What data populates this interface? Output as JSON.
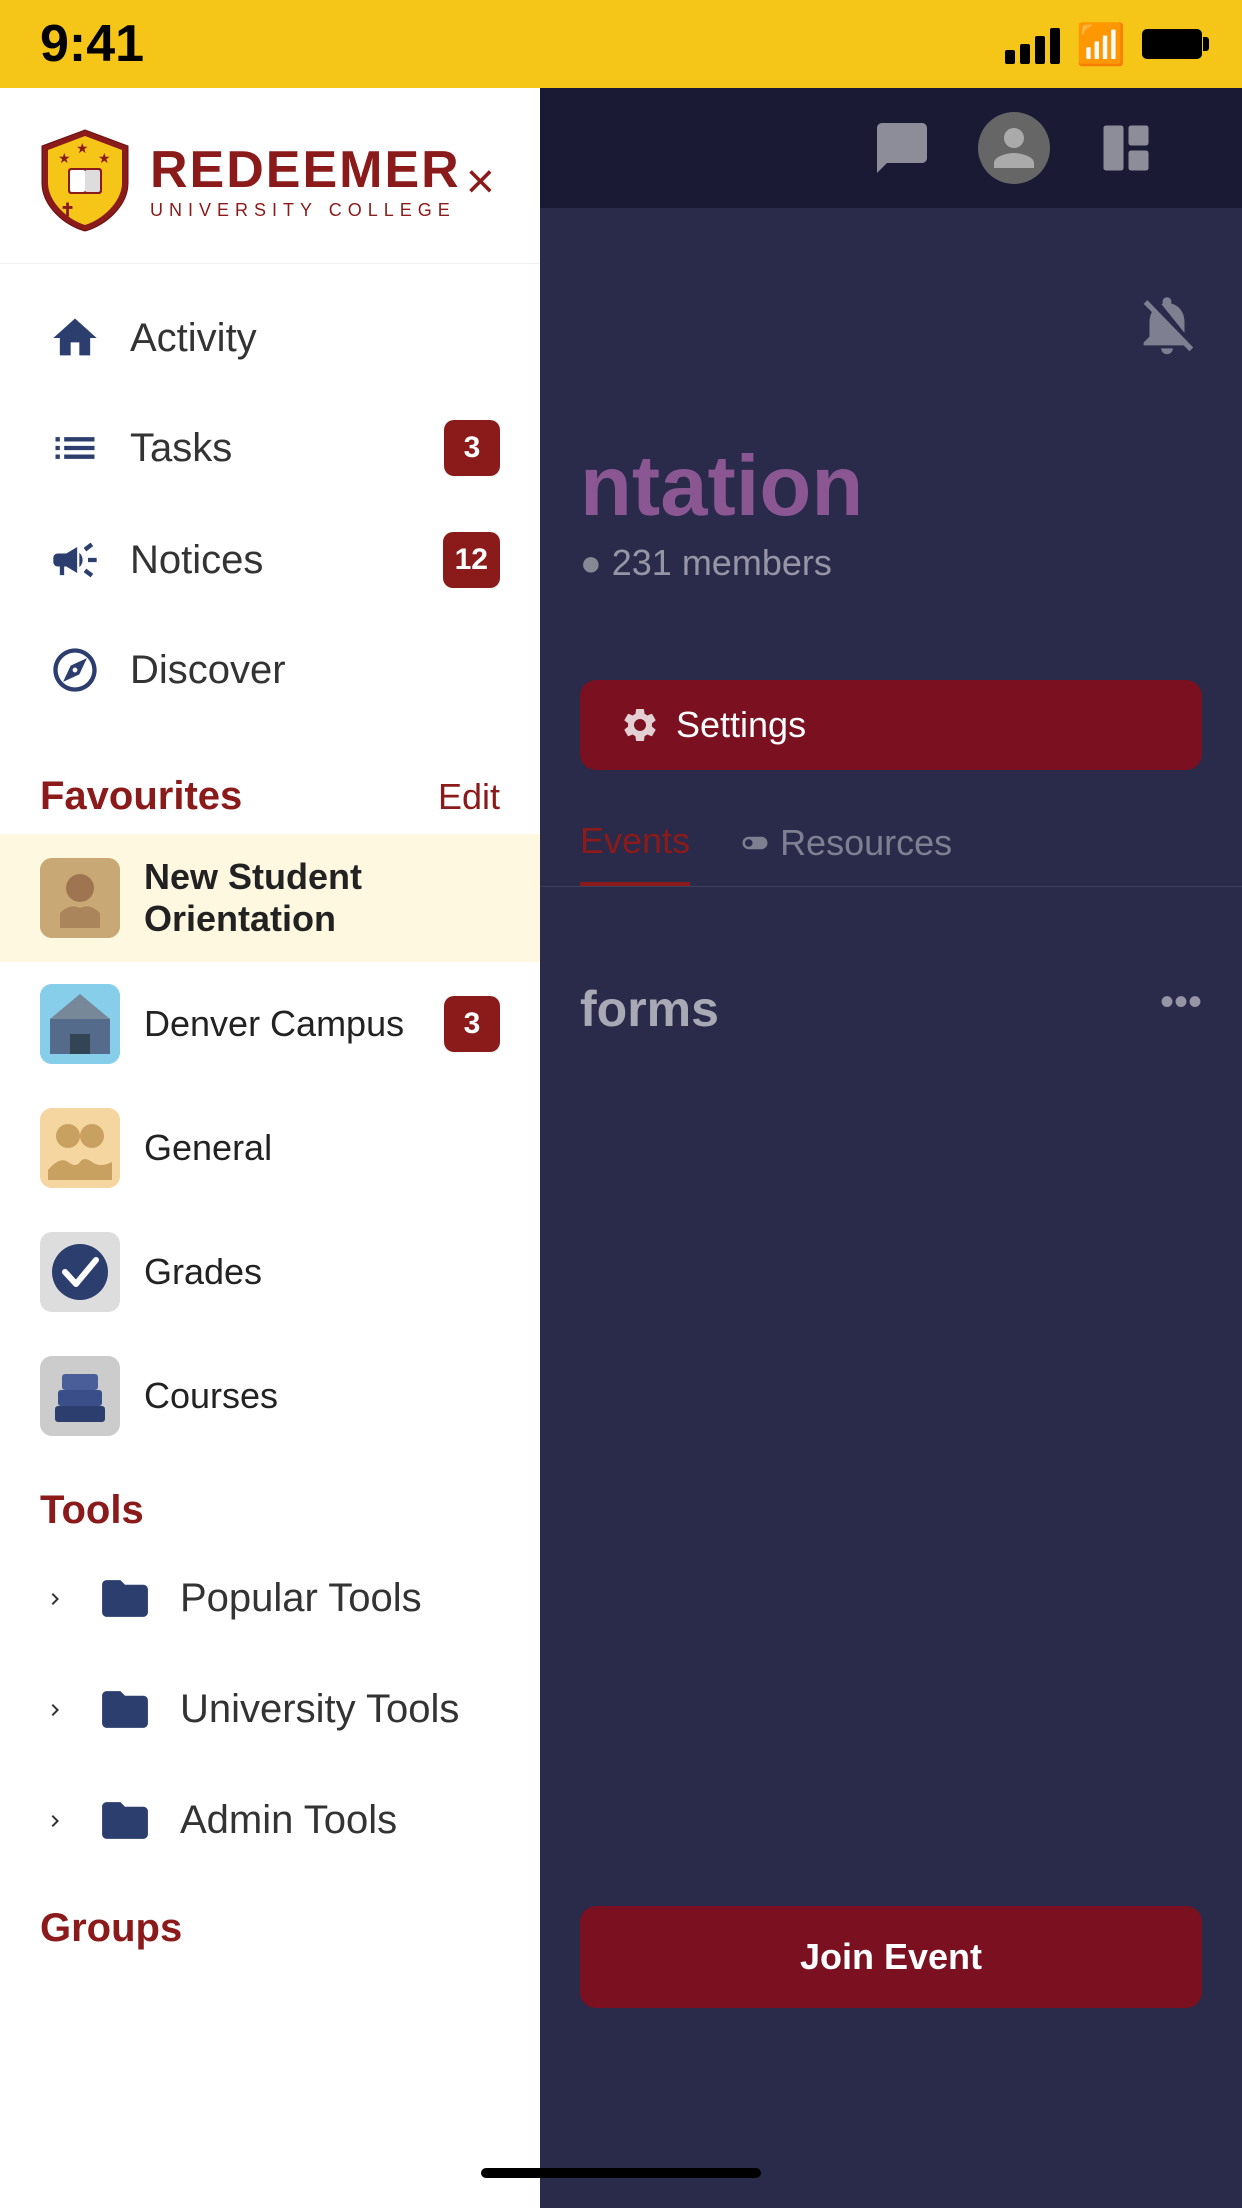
{
  "statusBar": {
    "time": "9:41",
    "signalBars": [
      14,
      20,
      28,
      36
    ],
    "batteryFull": true
  },
  "logo": {
    "university": "REDEEMER",
    "subtitle": "UNIVERSITY COLLEGE",
    "closeLabel": "×"
  },
  "navItems": [
    {
      "id": "activity",
      "label": "Activity",
      "icon": "home",
      "badge": null
    },
    {
      "id": "tasks",
      "label": "Tasks",
      "icon": "tasks",
      "badge": "3"
    },
    {
      "id": "notices",
      "label": "Notices",
      "icon": "megaphone",
      "badge": "12"
    },
    {
      "id": "discover",
      "label": "Discover",
      "icon": "compass",
      "badge": null
    }
  ],
  "favourites": {
    "sectionTitle": "Favourites",
    "editLabel": "Edit",
    "items": [
      {
        "id": "nso",
        "label": "New Student Orientation",
        "badge": null,
        "active": true
      },
      {
        "id": "denver",
        "label": "Denver Campus",
        "badge": "3",
        "active": false
      },
      {
        "id": "general",
        "label": "General",
        "badge": null,
        "active": false
      },
      {
        "id": "grades",
        "label": "Grades",
        "badge": null,
        "active": false
      },
      {
        "id": "courses",
        "label": "Courses",
        "badge": null,
        "active": false
      }
    ]
  },
  "tools": {
    "sectionTitle": "Tools",
    "items": [
      {
        "id": "popular",
        "label": "Popular Tools"
      },
      {
        "id": "university",
        "label": "University Tools"
      },
      {
        "id": "admin",
        "label": "Admin Tools"
      }
    ]
  },
  "groups": {
    "sectionTitle": "Groups"
  },
  "background": {
    "mainTitle": "ntation",
    "membersText": "231 members",
    "settingsLabel": "Settings",
    "tabs": [
      "Events",
      "Resources"
    ],
    "postTitle": "forms",
    "joinLabel": "Join Event",
    "notifIconMuted": true
  }
}
